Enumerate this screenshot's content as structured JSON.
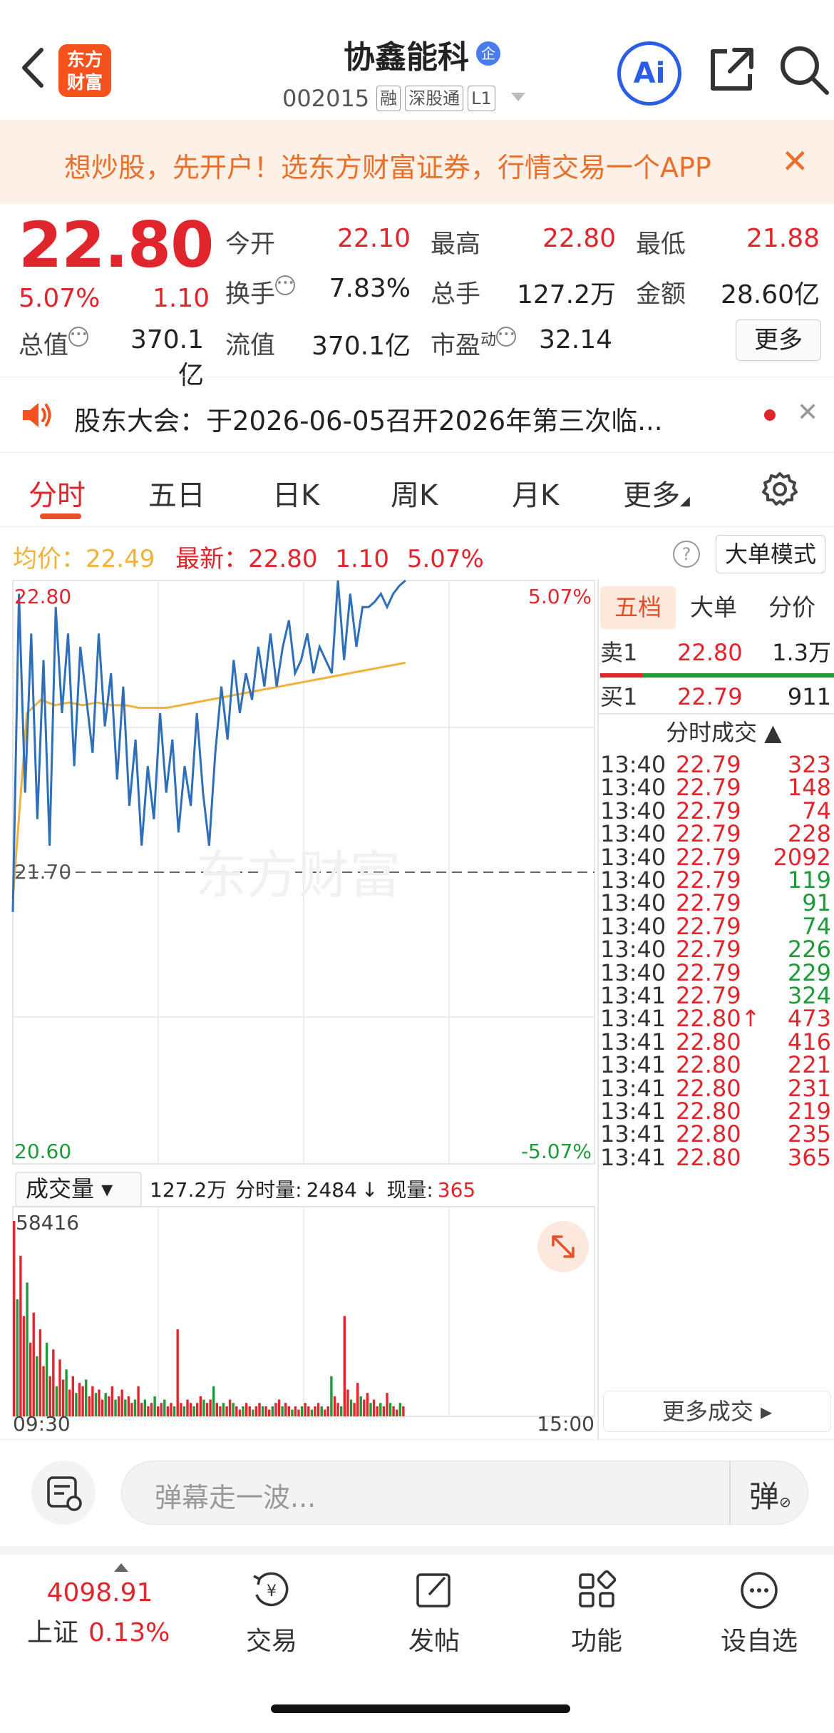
{
  "header": {
    "logo_top": "东方",
    "logo_bottom": "财富",
    "stock_name": "协鑫能科",
    "ent_badge": "企",
    "stock_code": "002015",
    "tags": [
      "融",
      "深股通",
      "L1"
    ],
    "ai_label": "Ai"
  },
  "banner": {
    "text": "想炒股，先开户！选东方财富证券，行情交易一个APP",
    "close": "✕"
  },
  "quote": {
    "price": "22.80",
    "change_pct": "5.07%",
    "change_amt": "1.10",
    "open_label": "今开",
    "open_value": "22.10",
    "high_label": "最高",
    "high_value": "22.80",
    "low_label": "最低",
    "low_value": "21.88",
    "turnover_label": "换手",
    "turnover_value": "7.83%",
    "volume_label": "总手",
    "volume_value": "127.2万",
    "amount_label": "金额",
    "amount_value": "28.60亿",
    "mktcap_label": "总值",
    "mktcap_value": "370.1亿",
    "float_label": "流值",
    "float_value": "370.1亿",
    "pe_label": "市盈",
    "pe_sup": "动",
    "pe_value": "32.14",
    "more_button": "更多"
  },
  "notice": {
    "text": "股东大会：于2026-06-05召开2026年第三次临...",
    "close": "✕"
  },
  "tabs": [
    "分时",
    "五日",
    "日K",
    "周K",
    "月K",
    "更多"
  ],
  "info_line": {
    "avg_label": "均价：",
    "avg_value": "22.49",
    "latest_label": "最新：",
    "latest_value": "22.80",
    "chg": "1.10",
    "pct": "5.07%",
    "help": "?",
    "big_mode": "大单模式"
  },
  "chart": {
    "y_top": "22.80",
    "y_mid": "21.70",
    "y_bottom": "20.60",
    "pct_top": "5.07%",
    "pct_bottom": "-5.07%",
    "watermark": "东方财富",
    "volume_selector": "成交量 ▾",
    "vol_total": "127.2万",
    "vol_minute_label": "分时量:",
    "vol_minute_value": "2484",
    "vol_now_label": "现量:",
    "vol_now_value": "365",
    "vol_max": "58416",
    "x_start": "09:30",
    "x_end": "15:00"
  },
  "chart_data": {
    "type": "line",
    "y_range": [
      20.6,
      22.8
    ],
    "prev_close": 21.7,
    "price_series": [
      21.55,
      22.75,
      22.0,
      22.6,
      21.9,
      22.5,
      21.8,
      22.7,
      22.3,
      22.6,
      22.1,
      22.55,
      22.35,
      22.15,
      22.6,
      22.25,
      22.45,
      22.05,
      22.4,
      21.95,
      22.2,
      21.8,
      22.1,
      21.9,
      22.3,
      22.0,
      22.2,
      21.85,
      22.1,
      21.95,
      22.3,
      22.0,
      21.8,
      22.15,
      22.4,
      22.2,
      22.5,
      22.3,
      22.45,
      22.35,
      22.55,
      22.4,
      22.6,
      22.4,
      22.55,
      22.65,
      22.45,
      22.5,
      22.6,
      22.45,
      22.55,
      22.5,
      22.45,
      22.8,
      22.5,
      22.75,
      22.55,
      22.7,
      22.7,
      22.72,
      22.75,
      22.7,
      22.75,
      22.78,
      22.8
    ],
    "avg_series": [
      21.6,
      22.3,
      22.35,
      22.33,
      22.34,
      22.33,
      22.34,
      22.33,
      22.33,
      22.32,
      22.32,
      22.32,
      22.33,
      22.34,
      22.35,
      22.36,
      22.37,
      22.38,
      22.39,
      22.4,
      22.41,
      22.42,
      22.43,
      22.44,
      22.45,
      22.46,
      22.47,
      22.48,
      22.49
    ],
    "volume_series": [
      58416,
      35000,
      48000,
      30000,
      40000,
      22000,
      31000,
      18000,
      26000,
      15000,
      22000,
      12000,
      20000,
      9000,
      17000,
      11000,
      14000,
      8000,
      12000,
      7000,
      10000,
      9000,
      11000,
      6000,
      9000,
      7000,
      8000,
      5000,
      7000,
      6000,
      9000,
      5000,
      6000,
      8000,
      5000,
      6000,
      4000,
      5000,
      9000,
      4000,
      5000,
      3000,
      4000,
      6000,
      3000,
      4000,
      5000,
      3000,
      4000,
      3000,
      26000,
      4000,
      3000,
      5000,
      4000,
      3000,
      4000,
      6000,
      5000,
      4000,
      5000,
      9000,
      4000,
      3000,
      4000,
      3000,
      5000,
      4000,
      3000,
      2000,
      3000,
      4000,
      3000,
      2000,
      3000,
      4000,
      3000,
      3000,
      2000,
      3000,
      4000,
      5000,
      3000,
      4000,
      3000,
      2000,
      3000,
      2000,
      3000,
      4000,
      3000,
      2000,
      3000,
      4000,
      3000,
      2000,
      3000,
      12000,
      6000,
      4000,
      3000,
      30000,
      8000,
      5000,
      4000,
      10000,
      6000,
      5000,
      7000,
      4000,
      5000,
      3000,
      4000,
      3000,
      7000,
      4000,
      3000,
      2000,
      4000,
      3000
    ]
  },
  "right_panel": {
    "tabs": [
      "五档",
      "大单",
      "分价"
    ],
    "sell1": {
      "label": "卖1",
      "price": "22.80",
      "vol": "1.3万"
    },
    "buy1": {
      "label": "买1",
      "price": "22.79",
      "vol": "911"
    },
    "trades_header": "分时成交 ▲",
    "trades": [
      {
        "t": "13:40",
        "p": "22.79",
        "v": "323",
        "c": "red"
      },
      {
        "t": "13:40",
        "p": "22.79",
        "v": "148",
        "c": "red"
      },
      {
        "t": "13:40",
        "p": "22.79",
        "v": "74",
        "c": "red"
      },
      {
        "t": "13:40",
        "p": "22.79",
        "v": "228",
        "c": "red"
      },
      {
        "t": "13:40",
        "p": "22.79",
        "v": "2092",
        "c": "red"
      },
      {
        "t": "13:40",
        "p": "22.79",
        "v": "119",
        "c": "green"
      },
      {
        "t": "13:40",
        "p": "22.79",
        "v": "91",
        "c": "green"
      },
      {
        "t": "13:40",
        "p": "22.79",
        "v": "74",
        "c": "green"
      },
      {
        "t": "13:40",
        "p": "22.79",
        "v": "226",
        "c": "green"
      },
      {
        "t": "13:40",
        "p": "22.79",
        "v": "229",
        "c": "green"
      },
      {
        "t": "13:41",
        "p": "22.79",
        "v": "324",
        "c": "green"
      },
      {
        "t": "13:41",
        "p": "22.80↑",
        "v": "473",
        "c": "red"
      },
      {
        "t": "13:41",
        "p": "22.80",
        "v": "416",
        "c": "red"
      },
      {
        "t": "13:41",
        "p": "22.80",
        "v": "221",
        "c": "red"
      },
      {
        "t": "13:41",
        "p": "22.80",
        "v": "231",
        "c": "red"
      },
      {
        "t": "13:41",
        "p": "22.80",
        "v": "219",
        "c": "red"
      },
      {
        "t": "13:41",
        "p": "22.80",
        "v": "235",
        "c": "red"
      },
      {
        "t": "13:41",
        "p": "22.80",
        "v": "365",
        "c": "red"
      }
    ],
    "more_trades": "更多成交 ▸"
  },
  "comment": {
    "placeholder": "弹幕走一波...",
    "dan": "弹"
  },
  "bottom_bar": {
    "index_value": "4098.91",
    "index_name": "上证",
    "index_pct": "0.13%",
    "items": [
      "交易",
      "发帖",
      "功能",
      "设自选"
    ]
  },
  "colors": {
    "up": "#e0262c",
    "down": "#1f9a3a",
    "price_line": "#2e6fb8",
    "avg_line": "#f0b23a",
    "accent": "#e8502a"
  }
}
